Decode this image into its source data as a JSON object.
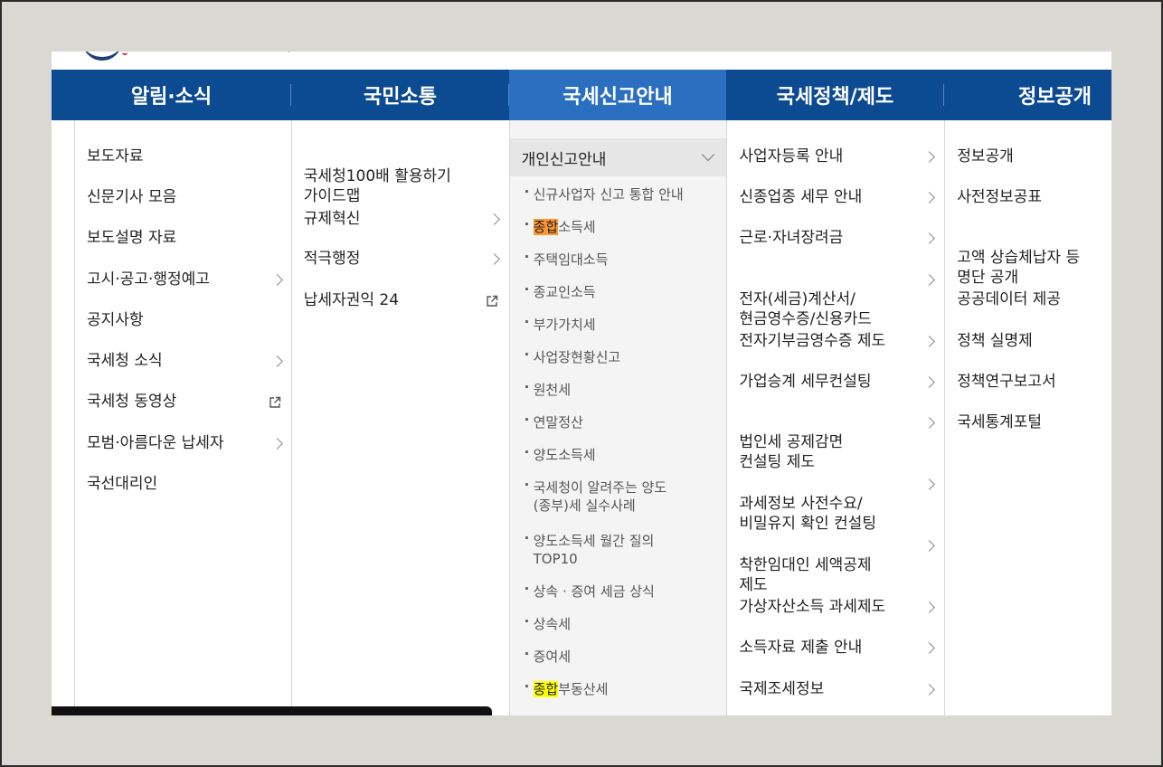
{
  "nav": {
    "items": [
      {
        "label": "알림·소식"
      },
      {
        "label": "국민소통"
      },
      {
        "label": "국세신고안내"
      },
      {
        "label": "국세정책/제도"
      },
      {
        "label": "정보공개"
      }
    ],
    "active_index": 2
  },
  "col1": {
    "items": [
      {
        "label": "보도자료"
      },
      {
        "label": "신문기사 모음"
      },
      {
        "label": "보도설명 자료"
      },
      {
        "label": "고시·공고·행정예고"
      },
      {
        "label": "공지사항"
      },
      {
        "label": "국세청 소식"
      },
      {
        "label": "국세청 동영상"
      },
      {
        "label": "모범·아름다운 납세자"
      },
      {
        "label": "국선대리인"
      }
    ]
  },
  "col2": {
    "items": [
      {
        "label": "국세청100배 활용하기\n가이드맵"
      },
      {
        "label": "규제혁신"
      },
      {
        "label": "적극행정"
      },
      {
        "label": "납세자권익 24"
      }
    ]
  },
  "col3": {
    "header": "개인신고안내",
    "items": [
      {
        "label": "신규사업자 신고 통합 안내"
      },
      {
        "label_hl": "종합",
        "label_rest": "소득세"
      },
      {
        "label": "주택임대소득"
      },
      {
        "label": "종교인소득"
      },
      {
        "label": "부가가치세"
      },
      {
        "label": "사업장현황신고"
      },
      {
        "label": "원천세"
      },
      {
        "label": "연말정산"
      },
      {
        "label": "양도소득세"
      },
      {
        "label": "국세청이 알려주는 양도\n(종부)세 실수사례"
      },
      {
        "label": "양도소득세 월간 질의\nTOP10"
      },
      {
        "label": "상속 · 증여 세금 상식"
      },
      {
        "label": "상속세"
      },
      {
        "label": "증여세"
      },
      {
        "label_hl": "종합",
        "label_rest": "부동산세"
      }
    ]
  },
  "col4": {
    "items": [
      {
        "label": "사업자등록 안내"
      },
      {
        "label": "신종업종 세무 안내"
      },
      {
        "label": "근로·자녀장려금"
      },
      {
        "label": "전자(세금)계산서/\n현금영수증/신용카드"
      },
      {
        "label": "전자기부금영수증 제도"
      },
      {
        "label": "가업승계 세무컨설팅"
      },
      {
        "label": "법인세 공제감면\n컨설팅 제도"
      },
      {
        "label": "과세정보 사전수요/\n비밀유지 확인 컨설팅"
      },
      {
        "label": "착한임대인 세액공제\n제도"
      },
      {
        "label": "가상자산소득 과세제도"
      },
      {
        "label": "소득자료 제출 안내"
      },
      {
        "label": "국제조세정보"
      }
    ]
  },
  "col5": {
    "items": [
      {
        "label": "정보공개"
      },
      {
        "label": "사전정보공표"
      },
      {
        "label": "고액 상습체납자 등\n명단 공개"
      },
      {
        "label": "공공데이터 제공"
      },
      {
        "label": "정책 실명제"
      },
      {
        "label": "정책연구보고서"
      },
      {
        "label": "국세통계포털"
      }
    ]
  },
  "colors": {
    "nav_bg": "#0c4a91",
    "nav_active": "#2a6fc0",
    "highlight_orange": "#ff9632",
    "highlight_yellow": "#ffff00"
  }
}
